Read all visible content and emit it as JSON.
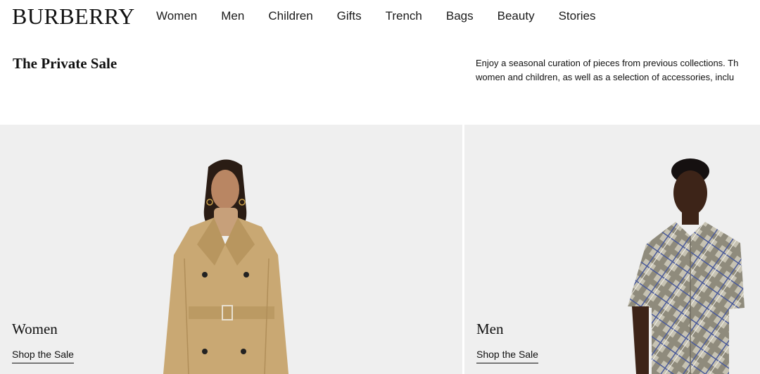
{
  "header": {
    "logo": "BURBERRY",
    "nav": [
      {
        "label": "Women"
      },
      {
        "label": "Men"
      },
      {
        "label": "Children"
      },
      {
        "label": "Gifts"
      },
      {
        "label": "Trench"
      },
      {
        "label": "Bags"
      },
      {
        "label": "Beauty"
      },
      {
        "label": "Stories"
      }
    ]
  },
  "intro": {
    "title": "The Private Sale",
    "text_line1": "Enjoy a seasonal curation of pieces from previous collections. Th",
    "text_line2": "women and children, as well as a selection of accessories, inclu"
  },
  "tiles": [
    {
      "label": "Women",
      "link": "Shop the Sale"
    },
    {
      "label": "Men",
      "link": "Shop the Sale"
    }
  ],
  "colors": {
    "tile_background": "#efefef",
    "trench_coat": "#c9a873",
    "check_shirt": "#c7c3b3"
  }
}
